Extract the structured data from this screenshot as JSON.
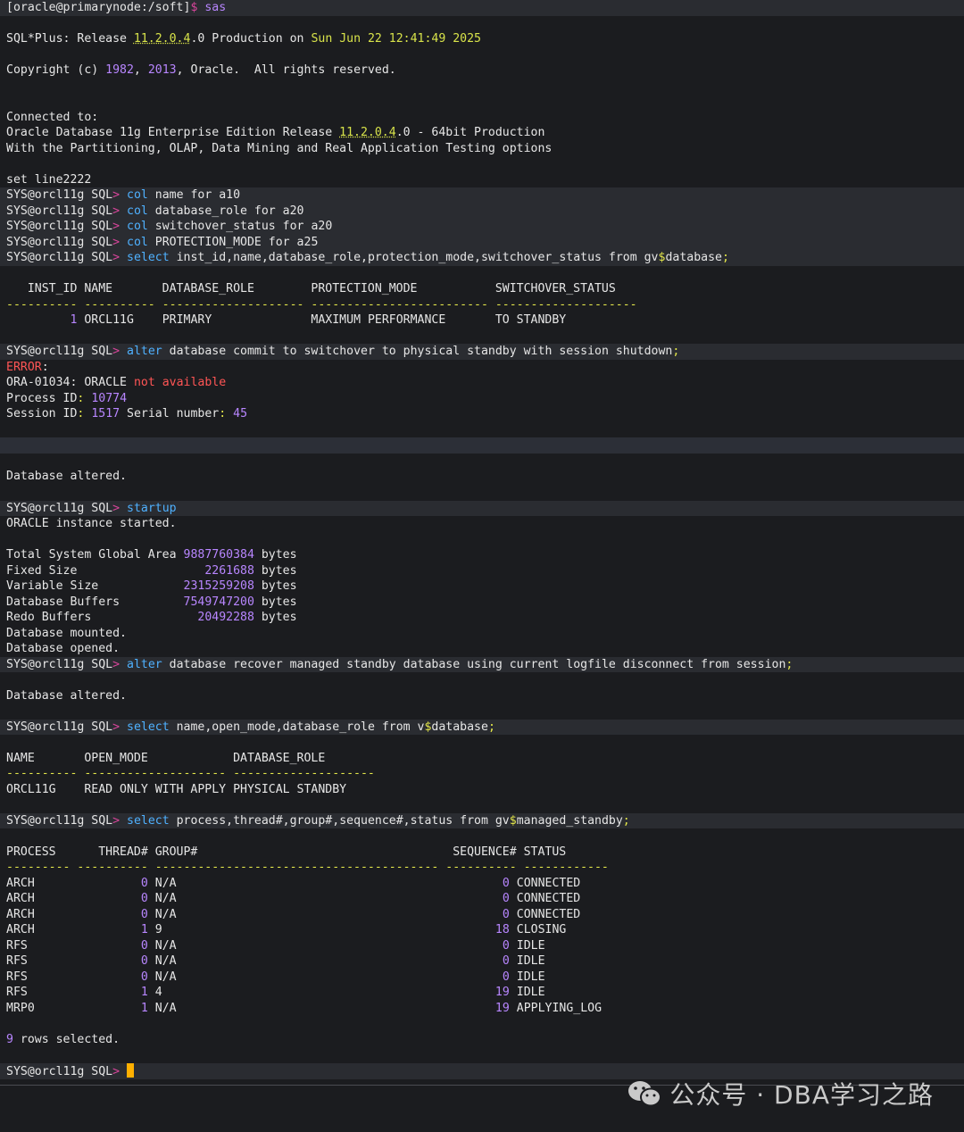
{
  "colors": {
    "background": "#1b1c1f",
    "text": "#e6e6e6",
    "prompt_gt": "#d9459b",
    "keyword": "#4fb1ff",
    "number": "#b886ff",
    "version": "#d8e34a",
    "error": "#ff5555",
    "cursor": "#ffb000"
  },
  "shell": {
    "prompt": "[oracle@primarynode:/soft]",
    "dollar": "$",
    "cmd": "sas"
  },
  "banner": {
    "l1_a": "SQL*Plus: Release ",
    "l1_ver": "11.2.0.4",
    "l1_b": ".0 Production on ",
    "l1_date": "Sun Jun 22 12:41:49 2025",
    "l2_a": "Copyright (c) ",
    "y1": "1982",
    "comma": ", ",
    "y2": "2013",
    "l2_b": ", Oracle.  All rights reserved.",
    "l3": "Connected to:",
    "l4_a": "Oracle Database 11g Enterprise Edition Release ",
    "l4_ver": "11.2.0.4",
    "l4_b": ".0 - 64bit Production",
    "l5": "With the Partitioning, OLAP, Data Mining and Real Application Testing options",
    "l6": "set line2222"
  },
  "sql_prompt": "SYS@orcl11g SQL",
  "cmds": {
    "c1": "col",
    "c1_rest": " name for a10",
    "c2": "col",
    "c2_rest": " database_role for a20",
    "c3": "col",
    "c3_rest": " switchover_status for a20",
    "c4": "col",
    "c4_rest": " PROTECTION_MODE for a25",
    "c5": "select",
    "c5_rest": " inst_id,name,database_role,protection_mode,switchover_status from gv",
    "c5_dollar": "$",
    "c5_end": "database",
    "c6": "alter",
    "c6_rest": " database commit to switchover to physical standby with session shutdown",
    "c7": "startup",
    "c8": "alter",
    "c8_rest": " database recover managed standby database using current logfile disconnect from session",
    "c9": "select",
    "c9_rest": " name,open_mode,database_role from v",
    "c9_end": "database",
    "c10": "select",
    "c10_rest": " process,thread#,group#,sequence#,status from gv",
    "c10_end": "managed_standby"
  },
  "q1": {
    "header": "   INST_ID NAME       DATABASE_ROLE        PROTECTION_MODE           SWITCHOVER_STATUS",
    "dashes": "---------- ---------- -------------------- ------------------------- --------------------",
    "row_pad": "         ",
    "row_id": "1",
    "row_rest": " ORCL11G    PRIMARY              MAXIMUM PERFORMANCE       TO STANDBY"
  },
  "error": {
    "label": "ERROR",
    "ora": "ORA-01034",
    "ora_mid": ": ORACLE ",
    "ora_err": "not available",
    "pid_label": "Process ID",
    "pid": "10774",
    "sid_label": "Session ID",
    "sid": "1517",
    "serial_label": " Serial number",
    "serial": "45"
  },
  "altered": "Database altered.",
  "startup_msg": "ORACLE instance started.",
  "sga": [
    {
      "label": "Total System Global Area ",
      "value": "9887760384",
      "unit": " bytes"
    },
    {
      "label": "Fixed Size               ",
      "value": "   2261688",
      "unit": " bytes"
    },
    {
      "label": "Variable Size            ",
      "value": "2315259208",
      "unit": " bytes"
    },
    {
      "label": "Database Buffers         ",
      "value": "7549747200",
      "unit": " bytes"
    },
    {
      "label": "Redo Buffers             ",
      "value": "  20492288",
      "unit": " bytes"
    }
  ],
  "mounted": "Database mounted.",
  "opened": "Database opened.",
  "q2": {
    "header": "NAME       OPEN_MODE            DATABASE_ROLE",
    "dashes": "---------- -------------------- --------------------",
    "row": "ORCL11G    READ ONLY WITH APPLY PHYSICAL STANDBY"
  },
  "q3": {
    "header": "PROCESS      THREAD# GROUP#                                    SEQUENCE# STATUS",
    "dashes": "--------- ---------- ---------------------------------------- ---------- ------------",
    "rows": [
      {
        "process": "ARCH     ",
        "thread": "0",
        "group": "N/A                                     ",
        "seq": "0",
        "status": "CONNECTED"
      },
      {
        "process": "ARCH     ",
        "thread": "0",
        "group": "N/A                                     ",
        "seq": "0",
        "status": "CONNECTED"
      },
      {
        "process": "ARCH     ",
        "thread": "0",
        "group": "N/A                                     ",
        "seq": "0",
        "status": "CONNECTED"
      },
      {
        "process": "ARCH     ",
        "thread": "1",
        "group": "9                                       ",
        "seq": "18",
        "status": "CLOSING"
      },
      {
        "process": "RFS      ",
        "thread": "0",
        "group": "N/A                                     ",
        "seq": "0",
        "status": "IDLE"
      },
      {
        "process": "RFS      ",
        "thread": "0",
        "group": "N/A                                     ",
        "seq": "0",
        "status": "IDLE"
      },
      {
        "process": "RFS      ",
        "thread": "0",
        "group": "N/A                                     ",
        "seq": "0",
        "status": "IDLE"
      },
      {
        "process": "RFS      ",
        "thread": "1",
        "group": "4                                       ",
        "seq": "19",
        "status": "IDLE"
      },
      {
        "process": "MRP0     ",
        "thread": "1",
        "group": "N/A                                     ",
        "seq": "19",
        "status": "APPLYING_LOG"
      }
    ]
  },
  "rows_count": "9",
  "rows_selected": " rows selected.",
  "watermark": "公众号 · DBA学习之路"
}
